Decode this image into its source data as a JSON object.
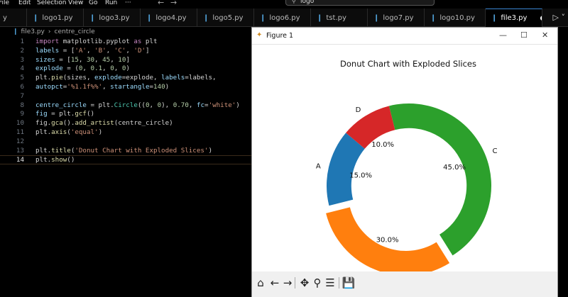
{
  "menu": {
    "items": [
      "File",
      "Edit",
      "Selection",
      "View",
      "Go",
      "Run",
      "···"
    ],
    "search_text": "logo"
  },
  "tabs": [
    {
      "label": "y",
      "active": false
    },
    {
      "label": "logo1.py",
      "active": false
    },
    {
      "label": "logo3.py",
      "active": false
    },
    {
      "label": "logo4.py",
      "active": false
    },
    {
      "label": "logo5.py",
      "active": false
    },
    {
      "label": "logo6.py",
      "active": false
    },
    {
      "label": "tst.py",
      "active": false
    },
    {
      "label": "logo7.py",
      "active": false
    },
    {
      "label": "logo10.py",
      "active": false
    },
    {
      "label": "file3.py",
      "active": true
    }
  ],
  "breadcrumb": {
    "file": "file3.py",
    "symbol": "centre_circle"
  },
  "editor": {
    "current_line": 14,
    "lines": [
      {
        "num": "1",
        "tokens": [
          [
            "kw",
            "import"
          ],
          [
            "t",
            " matplotlib.pyplot "
          ],
          [
            "kw",
            "as"
          ],
          [
            "t",
            " plt"
          ]
        ]
      },
      {
        "num": "2",
        "tokens": [
          [
            "var",
            "labels"
          ],
          [
            "t",
            " = ["
          ],
          [
            "str",
            "'A'"
          ],
          [
            "t",
            ", "
          ],
          [
            "str",
            "'B'"
          ],
          [
            "t",
            ", "
          ],
          [
            "str",
            "'C'"
          ],
          [
            "t",
            ", "
          ],
          [
            "str",
            "'D'"
          ],
          [
            "t",
            "]"
          ]
        ]
      },
      {
        "num": "3",
        "tokens": [
          [
            "var",
            "sizes"
          ],
          [
            "t",
            " = ["
          ],
          [
            "num",
            "15"
          ],
          [
            "t",
            ", "
          ],
          [
            "num",
            "30"
          ],
          [
            "t",
            ", "
          ],
          [
            "num",
            "45"
          ],
          [
            "t",
            ", "
          ],
          [
            "num",
            "10"
          ],
          [
            "t",
            "]"
          ]
        ]
      },
      {
        "num": "4",
        "tokens": [
          [
            "var",
            "explode"
          ],
          [
            "t",
            " = ("
          ],
          [
            "num",
            "0"
          ],
          [
            "t",
            ", "
          ],
          [
            "num",
            "0.1"
          ],
          [
            "t",
            ", "
          ],
          [
            "num",
            "0"
          ],
          [
            "t",
            ", "
          ],
          [
            "num",
            "0"
          ],
          [
            "t",
            ")"
          ]
        ]
      },
      {
        "num": "5",
        "tokens": [
          [
            "t",
            "plt."
          ],
          [
            "fn",
            "pie"
          ],
          [
            "t",
            "(sizes, "
          ],
          [
            "var",
            "explode"
          ],
          [
            "t",
            "=explode, "
          ],
          [
            "var",
            "labels"
          ],
          [
            "t",
            "=labels,"
          ]
        ]
      },
      {
        "num": "6",
        "tokens": [
          [
            "var",
            "autopct"
          ],
          [
            "t",
            "="
          ],
          [
            "str",
            "'%1.1f%%'"
          ],
          [
            "t",
            ", "
          ],
          [
            "var",
            "startangle"
          ],
          [
            "t",
            "="
          ],
          [
            "num",
            "140"
          ],
          [
            "t",
            ")"
          ]
        ]
      },
      {
        "num": "7",
        "tokens": []
      },
      {
        "num": "8",
        "tokens": [
          [
            "var",
            "centre_circle"
          ],
          [
            "t",
            " = plt."
          ],
          [
            "cls",
            "Circle"
          ],
          [
            "t",
            "(("
          ],
          [
            "num",
            "0"
          ],
          [
            "t",
            ", "
          ],
          [
            "num",
            "0"
          ],
          [
            "t",
            "), "
          ],
          [
            "num",
            "0.70"
          ],
          [
            "t",
            ", "
          ],
          [
            "var",
            "fc"
          ],
          [
            "t",
            "="
          ],
          [
            "str",
            "'white'"
          ],
          [
            "t",
            ")"
          ]
        ]
      },
      {
        "num": "9",
        "tokens": [
          [
            "var",
            "fig"
          ],
          [
            "t",
            " = plt."
          ],
          [
            "fn",
            "gcf"
          ],
          [
            "t",
            "()"
          ]
        ]
      },
      {
        "num": "10",
        "tokens": [
          [
            "t",
            "fig."
          ],
          [
            "fn",
            "gca"
          ],
          [
            "t",
            "()."
          ],
          [
            "fn",
            "add_artist"
          ],
          [
            "t",
            "(centre_circle)"
          ]
        ]
      },
      {
        "num": "11",
        "tokens": [
          [
            "t",
            "plt."
          ],
          [
            "fn",
            "axis"
          ],
          [
            "t",
            "("
          ],
          [
            "str",
            "'equal'"
          ],
          [
            "t",
            ")"
          ]
        ]
      },
      {
        "num": "12",
        "tokens": []
      },
      {
        "num": "13",
        "tokens": [
          [
            "t",
            "plt."
          ],
          [
            "fn",
            "title"
          ],
          [
            "t",
            "("
          ],
          [
            "str",
            "'Donut Chart with Exploded Slices'"
          ],
          [
            "t",
            ")"
          ]
        ]
      },
      {
        "num": "14",
        "tokens": [
          [
            "t",
            "plt."
          ],
          [
            "fn",
            "show"
          ],
          [
            "t",
            "()"
          ]
        ]
      }
    ]
  },
  "figure": {
    "window_title": "Figure 1"
  },
  "chart_data": {
    "type": "pie",
    "title": "Donut Chart with Exploded Slices",
    "labels": [
      "A",
      "B",
      "C",
      "D"
    ],
    "values": [
      15,
      30,
      45,
      10
    ],
    "pct_labels": [
      "15.0%",
      "30.0%",
      "45.0%",
      "10.0%"
    ],
    "colors": [
      "#1f77b4",
      "#ff7f0e",
      "#2ca02c",
      "#d62728"
    ],
    "explode": [
      0,
      0.1,
      0,
      0
    ],
    "startangle": 140,
    "hole_ratio": 0.7
  },
  "toolbar": {
    "icons": [
      "home-icon",
      "back-icon",
      "forward-icon",
      "pan-icon",
      "zoom-icon",
      "configure-subplots-icon",
      "save-icon"
    ]
  }
}
